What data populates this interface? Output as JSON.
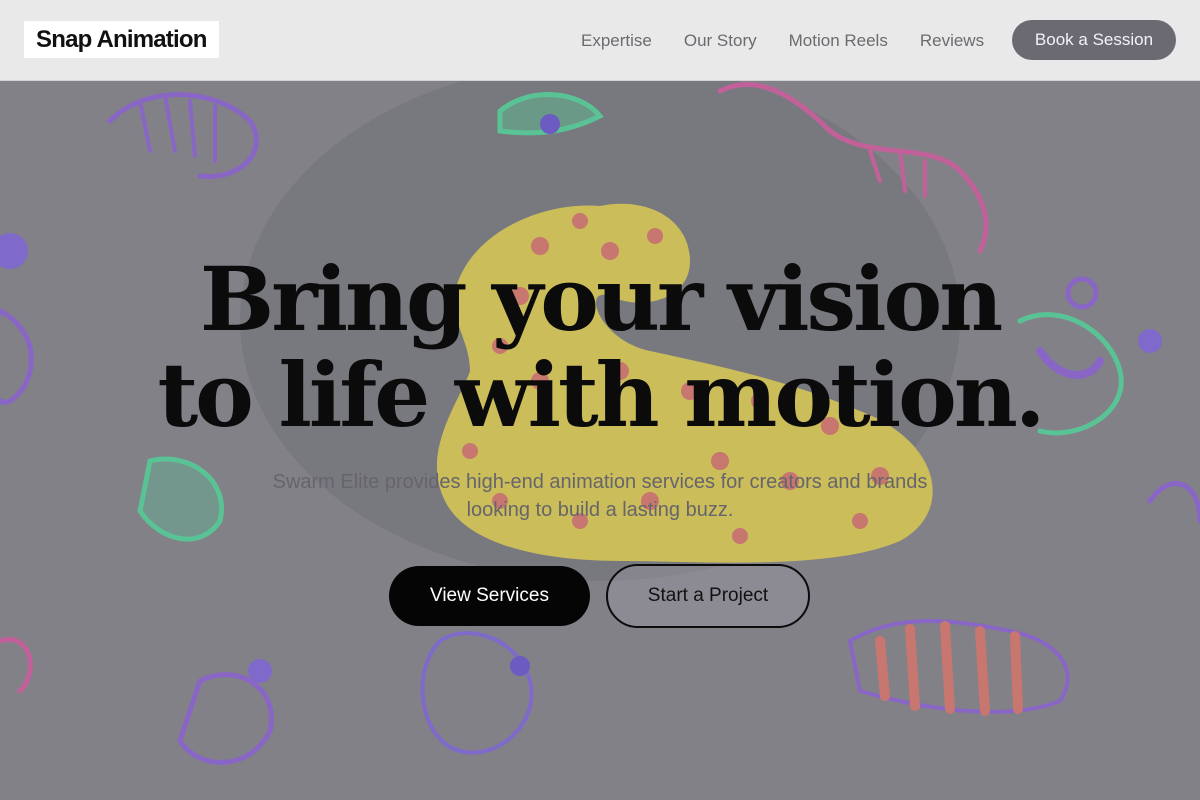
{
  "brand": {
    "logo_text": "Snap Animation"
  },
  "nav": {
    "links": [
      "Expertise",
      "Our Story",
      "Motion Reels",
      "Reviews"
    ],
    "cta_label": "Book a Session"
  },
  "hero": {
    "headline_line1": "Bring your vision",
    "headline_line2": "to life with motion.",
    "subtext": "Swarm Elite provides high-end animation services for creators and brands looking to build a lasting buzz.",
    "primary_button": "View Services",
    "secondary_button": "Start a Project",
    "background_description": "glowing neon doodle creatures around a yellow spotted clay figure"
  },
  "colors": {
    "navbar_bg": "#e9e9ea",
    "nav_text": "#6b6b70",
    "cta_bg": "#6b6a72",
    "primary_button_bg": "#050505",
    "headline": "#0b0b0b",
    "accent_yellow": "#f4dd3a",
    "accent_pink": "#e64aa0",
    "accent_violet": "#8a52e8",
    "accent_green": "#3ee79a"
  }
}
